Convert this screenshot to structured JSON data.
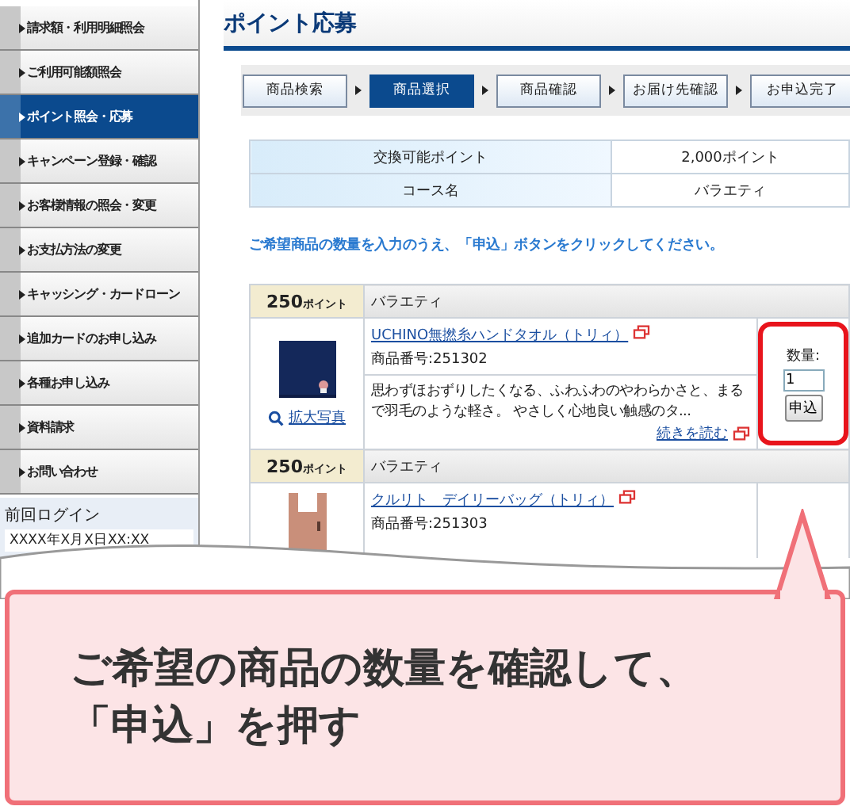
{
  "sidebar": {
    "items": [
      {
        "label": "請求額・利用明細照会",
        "selected": false
      },
      {
        "label": "ご利用可能額照会",
        "selected": false
      },
      {
        "label": "ポイント照会・応募",
        "selected": true
      },
      {
        "label": "キャンペーン登録・確認",
        "selected": false
      },
      {
        "label": "お客様情報の照会・変更",
        "selected": false
      },
      {
        "label": "お支払方法の変更",
        "selected": false
      },
      {
        "label": "キャッシング・カードローン",
        "selected": false
      },
      {
        "label": "追加カードのお申し込み",
        "selected": false
      },
      {
        "label": "各種お申し込み",
        "selected": false
      },
      {
        "label": "資料請求",
        "selected": false
      },
      {
        "label": "お問い合わせ",
        "selected": false
      }
    ],
    "last_login": {
      "label": "前回ログイン",
      "value": "XXXX年X月X日XX:XX"
    }
  },
  "title": "ポイント応募",
  "steps": [
    {
      "label": "商品検索",
      "selected": false
    },
    {
      "label": "商品選択",
      "selected": true
    },
    {
      "label": "商品確認",
      "selected": false
    },
    {
      "label": "お届け先確認",
      "selected": false
    },
    {
      "label": "お申込完了",
      "selected": false
    }
  ],
  "summary": [
    {
      "label": "交換可能ポイント",
      "value": "2,000ポイント"
    },
    {
      "label": "コース名",
      "value": "バラエティ"
    }
  ],
  "instruction": "ご希望商品の数量を入力のうえ、「申込」ボタンをクリックしてください。",
  "products": [
    {
      "points": "250",
      "points_unit": "ポイント",
      "course": "バラエティ",
      "name": "UCHINO無撚糸ハンドタオル（トリィ）",
      "number": "商品番号:251302",
      "description": "思わずほおずりしたくなる、ふわふわのやわらかさと、まるで羽毛のような軽さ。 やさしく心地良い触感のタ...",
      "read_more": "続きを読む",
      "zoom_link": "拡大写真",
      "quantity_label": "数量:",
      "quantity": "1",
      "apply_button": "申込",
      "highlighted": true
    },
    {
      "points": "250",
      "points_unit": "ポイント",
      "course": "バラエティ",
      "name": "クルリト　デイリーバッグ（トリィ）",
      "number": "商品番号:251303",
      "highlighted": false
    }
  ],
  "callout": {
    "lines": [
      "ご希望の商品の数量を確認して、",
      "「申込」を押す"
    ]
  }
}
